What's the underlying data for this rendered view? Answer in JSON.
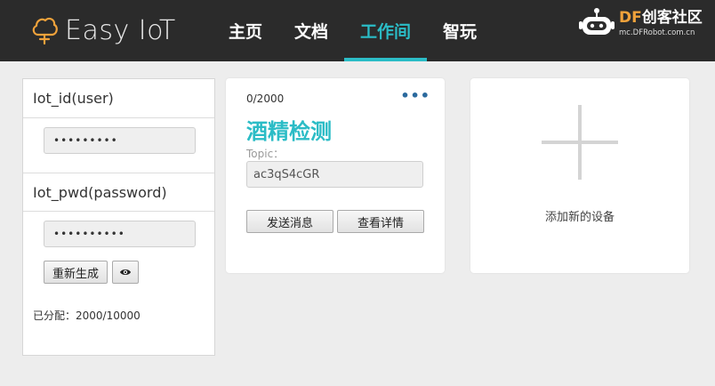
{
  "header": {
    "logo_text": "Easy IoT",
    "nav": [
      "主页",
      "文档",
      "工作间",
      "智玩"
    ],
    "active_nav": "工作间",
    "brand_letters": "DF",
    "brand_name": "创客社区",
    "brand_url": "mc.DFRobot.com.cn"
  },
  "account": {
    "iot_id_label": "Iot_id(user)",
    "iot_id_value": "•••••••••",
    "iot_pwd_label": "Iot_pwd(password)",
    "iot_pwd_value": "••••••••••",
    "regenerate_label": "重新生成",
    "allocated_text": "已分配：2000/10000"
  },
  "device": {
    "count": "0/2000",
    "more_label": "•••",
    "name": "酒精检测",
    "topic_label": "Topic：",
    "topic_value": "ac3qS4cGR",
    "send_label": "发送消息",
    "detail_label": "查看详情"
  },
  "add_device": {
    "label": "添加新的设备"
  },
  "colors": {
    "accent": "#2bbcc6",
    "header_bg": "#2b2b2b",
    "logo_orange": "#f0a23b"
  }
}
